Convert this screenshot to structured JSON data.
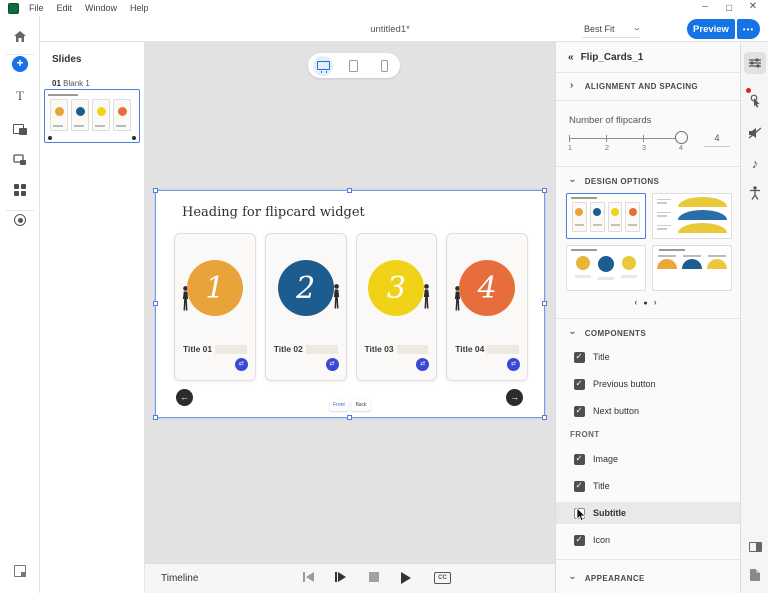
{
  "menu_bar": {
    "items": [
      "File",
      "Edit",
      "Window",
      "Help"
    ]
  },
  "window_controls": {
    "minimize": "–",
    "maximize": "▢",
    "close": "✕"
  },
  "toolbar": {
    "document_title": "untitled1*",
    "fit_select": "Best Fit",
    "preview_label": "Preview",
    "more_label": "•••"
  },
  "slides_panel": {
    "title": "Slides",
    "slide_number": "01",
    "slide_name": "Blank 1"
  },
  "canvas": {
    "heading": "Heading for flipcard widget",
    "front_label": "Front",
    "back_label": "Back",
    "cards": [
      {
        "number": "1",
        "title": "Title 01",
        "circle_color": "#E8A33B"
      },
      {
        "number": "2",
        "title": "Title 02",
        "circle_color": "#1D5C8F"
      },
      {
        "number": "3",
        "title": "Title 03",
        "circle_color": "#F0D318"
      },
      {
        "number": "4",
        "title": "Title 04",
        "circle_color": "#E76E3C"
      }
    ]
  },
  "timeline": {
    "label": "Timeline",
    "cc_label": "CC"
  },
  "right_panel": {
    "header": "Flip_Cards_1",
    "alignment_title": "ALIGNMENT AND SPACING",
    "flipcards": {
      "label": "Number of flipcards",
      "ticks": [
        "1",
        "2",
        "3",
        "4"
      ],
      "value": "4"
    },
    "design_options_title": "DESIGN OPTIONS",
    "components_title": "COMPONENTS",
    "components": [
      {
        "label": "Title",
        "checked": true
      },
      {
        "label": "Previous button",
        "checked": true
      },
      {
        "label": "Next button",
        "checked": true
      }
    ],
    "front_title": "FRONT",
    "front_items": [
      {
        "label": "Image",
        "checked": true
      },
      {
        "label": "Title",
        "checked": true
      },
      {
        "label": "Subtitle",
        "checked": false
      },
      {
        "label": "Icon",
        "checked": true
      }
    ],
    "appearance_title": "APPEARANCE"
  },
  "colors": {
    "accent": "#1473E6",
    "selection_border": "#4A7FE0",
    "badge": "#3B49D6",
    "circle_colors": [
      "#E8A33B",
      "#1D5C8F",
      "#F0D318",
      "#E76E3C"
    ]
  }
}
